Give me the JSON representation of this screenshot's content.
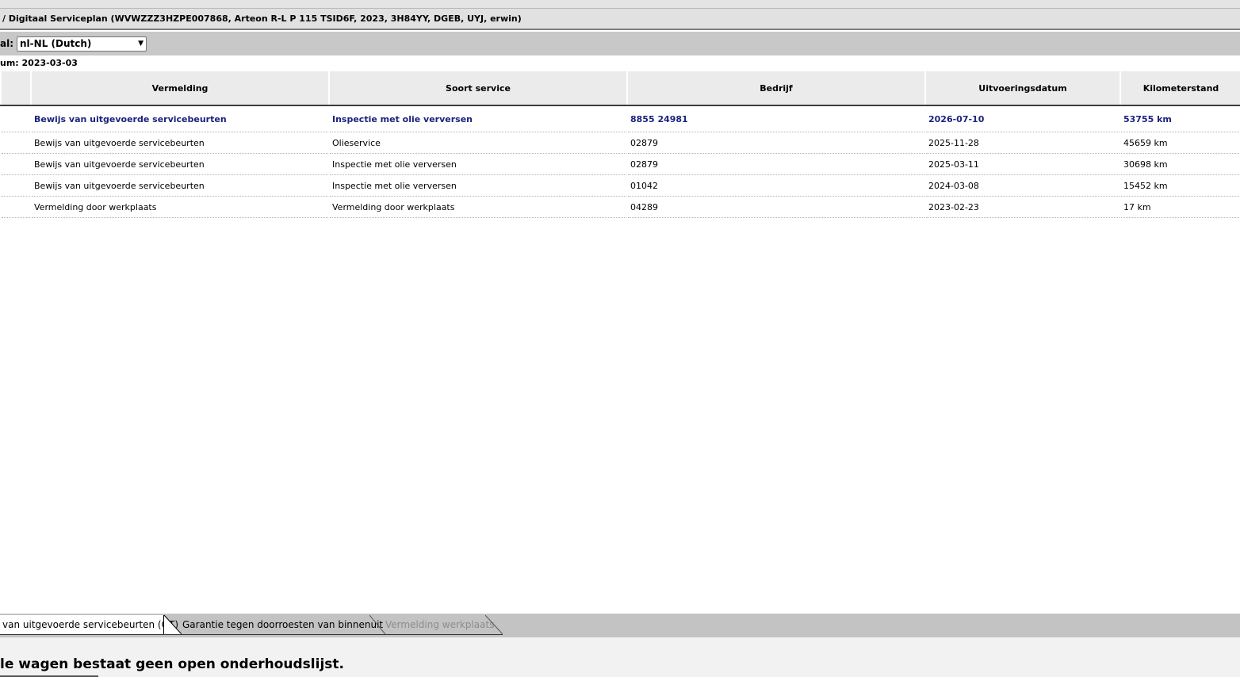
{
  "title_bar": {
    "text": "/ Digitaal Serviceplan (WVWZZZ3HZPE007868, Arteon R-L P 115 TSID6F, 2023, 3H84YY, DGEB, UYJ, erwin)"
  },
  "language": {
    "label": "al:",
    "selected": "nl-NL (Dutch)"
  },
  "date_line": "um: 2023-03-03",
  "table": {
    "headers": [
      "Vermelding",
      "Soort service",
      "Bedrijf",
      "Uitvoeringsdatum",
      "Kilometerstand"
    ],
    "rows": [
      [
        "Bewijs van uitgevoerde servicebeurten",
        "Inspectie met olie verversen",
        "8855 24981",
        "2026-07-10",
        "53755 km"
      ],
      [
        "Bewijs van uitgevoerde servicebeurten",
        "Olieservice",
        "02879",
        "2025-11-28",
        "45659 km"
      ],
      [
        "Bewijs van uitgevoerde servicebeurten",
        "Inspectie met olie verversen",
        "02879",
        "2025-03-11",
        "30698 km"
      ],
      [
        "Bewijs van uitgevoerde servicebeurten",
        "Inspectie met olie verversen",
        "01042",
        "2024-03-08",
        "15452 km"
      ],
      [
        "Vermelding door werkplaats",
        "Vermelding door werkplaats",
        "04289",
        "2023-02-23",
        "17 km"
      ]
    ]
  },
  "tabs": [
    {
      "label": "van uitgevoerde servicebeurten (OT)",
      "state": "active"
    },
    {
      "label": "Garantie tegen doorroesten van binnenuit",
      "state": "normal"
    },
    {
      "label": "Vermelding werkplaats",
      "state": "disabled"
    }
  ],
  "message": "le wagen bestaat geen open onderhoudslijst.",
  "colors": {
    "highlight_text": "#1a237e",
    "header_bg": "#ebebeb",
    "tabs_bg": "#c3c3c3"
  }
}
